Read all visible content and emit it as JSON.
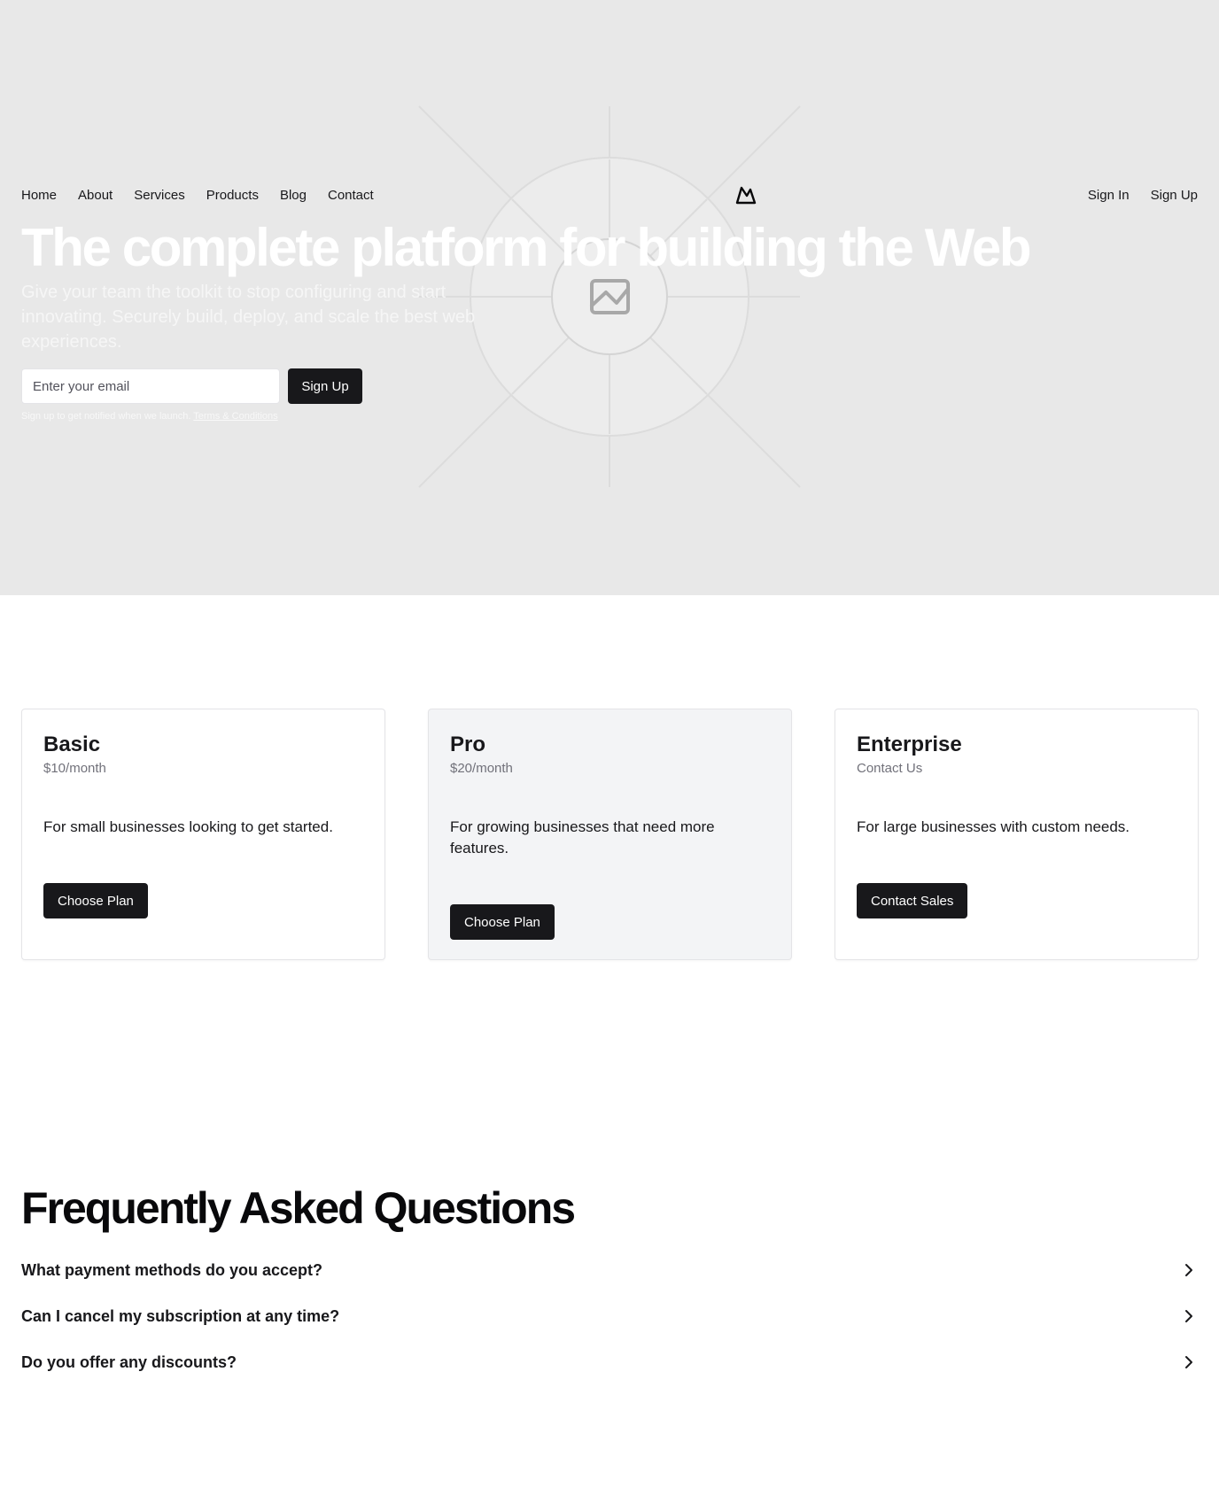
{
  "nav": {
    "links": [
      "Home",
      "About",
      "Services",
      "Products",
      "Blog",
      "Contact"
    ],
    "sign_in": "Sign In",
    "sign_up": "Sign Up"
  },
  "hero": {
    "title": "The complete platform for building the Web",
    "subtitle": "Give your team the toolkit to stop configuring and start innovating. Securely build, deploy, and scale the best web experiences.",
    "email_placeholder": "Enter your email",
    "signup_button": "Sign Up",
    "note": "Sign up to get notified when we launch.",
    "terms_link": "Terms & Conditions"
  },
  "plans": [
    {
      "name": "Basic",
      "price": "$10/month",
      "description": "For small businesses looking to get started.",
      "button": "Choose Plan"
    },
    {
      "name": "Pro",
      "price": "$20/month",
      "description": "For growing businesses that need more features.",
      "button": "Choose Plan"
    },
    {
      "name": "Enterprise",
      "price": "Contact Us",
      "description": "For large businesses with custom needs.",
      "button": "Contact Sales"
    }
  ],
  "faq": {
    "title": "Frequently Asked Questions",
    "items": [
      "What payment methods do you accept?",
      "Can I cancel my subscription at any time?",
      "Do you offer any discounts?"
    ]
  },
  "colors": {
    "hero_bg": "#e8e8e8",
    "dark_button": "#18181b",
    "featured_card": "#f3f4f6"
  },
  "icons": [
    "logo-icon",
    "image-placeholder-icon",
    "chevron-right-icon"
  ]
}
